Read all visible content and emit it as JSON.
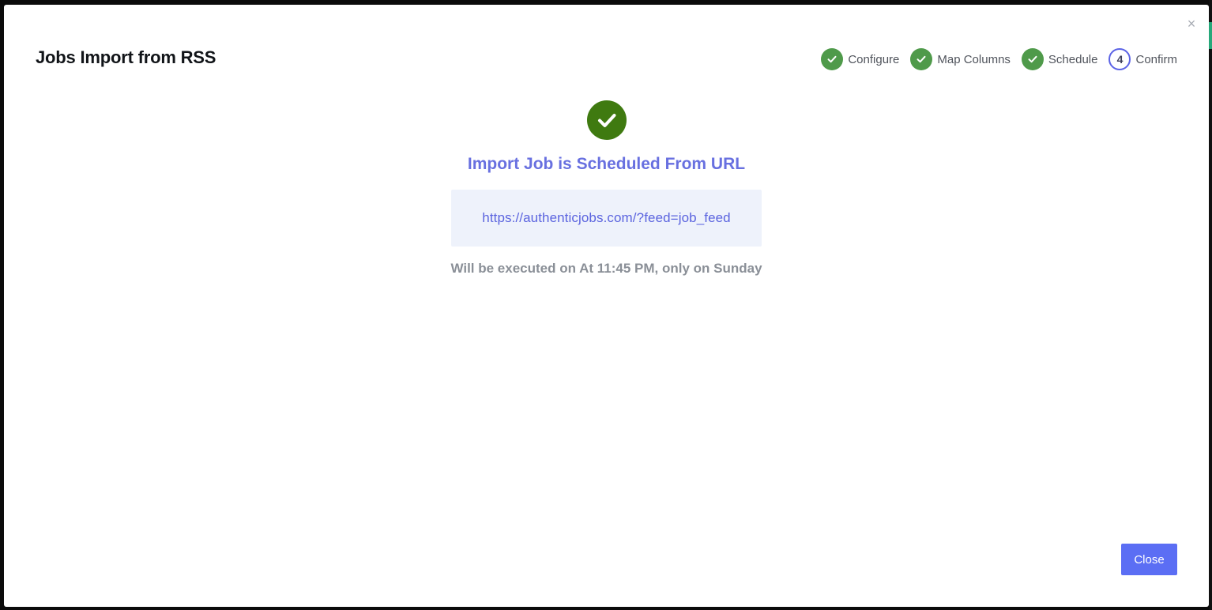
{
  "modal": {
    "title": "Jobs Import from RSS",
    "close_glyph": "×"
  },
  "stepper": {
    "steps": [
      {
        "label": "Configure",
        "state": "done"
      },
      {
        "label": "Map Columns",
        "state": "done"
      },
      {
        "label": "Schedule",
        "state": "done"
      },
      {
        "label": "Confirm",
        "state": "active",
        "number": "4"
      }
    ]
  },
  "result": {
    "icon": "check-circle-icon",
    "headline": "Import Job is Scheduled From URL",
    "url": "https://authenticjobs.com/?feed=job_feed",
    "schedule": "Will be executed on At 11:45 PM, only on Sunday"
  },
  "footer": {
    "close_label": "Close"
  },
  "colors": {
    "step_done": "#4f9a4a",
    "step_active_border": "#5b63e6",
    "success_icon": "#3f7a10",
    "headline": "#6870e0",
    "url_box_bg": "#eef2fb",
    "primary_button": "#5b6ef4"
  }
}
